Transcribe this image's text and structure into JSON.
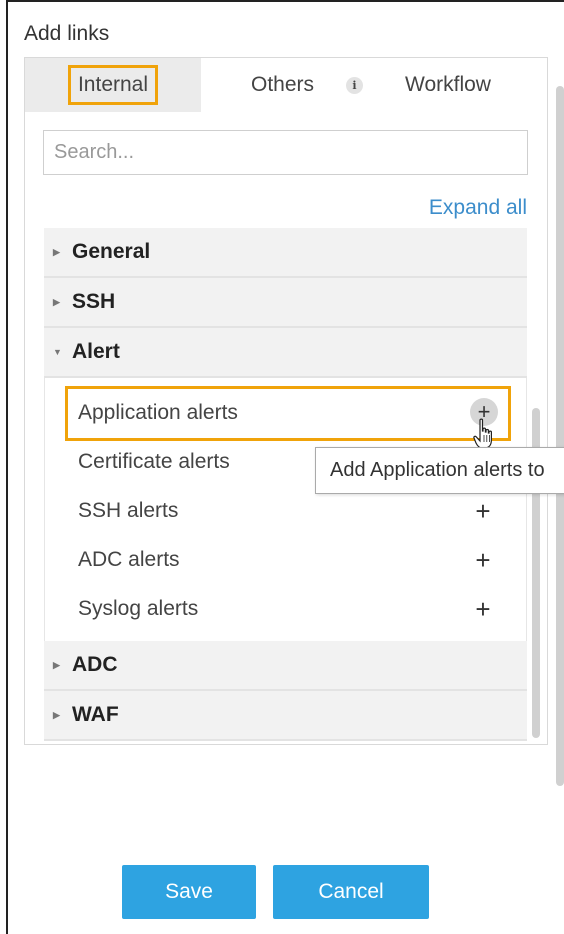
{
  "title": "Add links",
  "tabs": [
    {
      "label": "Internal",
      "active": true
    },
    {
      "label": "Others"
    },
    {
      "label": "Workflow"
    }
  ],
  "info_icon_glyph": "i",
  "search": {
    "placeholder": "Search...",
    "value": ""
  },
  "expand_all": "Expand all",
  "tree": {
    "general": "General",
    "ssh": "SSH",
    "alert": {
      "label": "Alert",
      "items": [
        {
          "label": "Application alerts",
          "add": "+"
        },
        {
          "label": "Certificate alerts",
          "add": "+"
        },
        {
          "label": "SSH alerts",
          "add": "+"
        },
        {
          "label": "ADC alerts",
          "add": "+"
        },
        {
          "label": "Syslog alerts",
          "add": "+"
        }
      ]
    },
    "adc": "ADC",
    "waf": "WAF"
  },
  "tooltip": "Add Application alerts to",
  "buttons": {
    "save": "Save",
    "cancel": "Cancel"
  },
  "colors": {
    "highlight": "#f0a30a",
    "accent": "#2ea3e1",
    "link": "#3c8dcb"
  }
}
